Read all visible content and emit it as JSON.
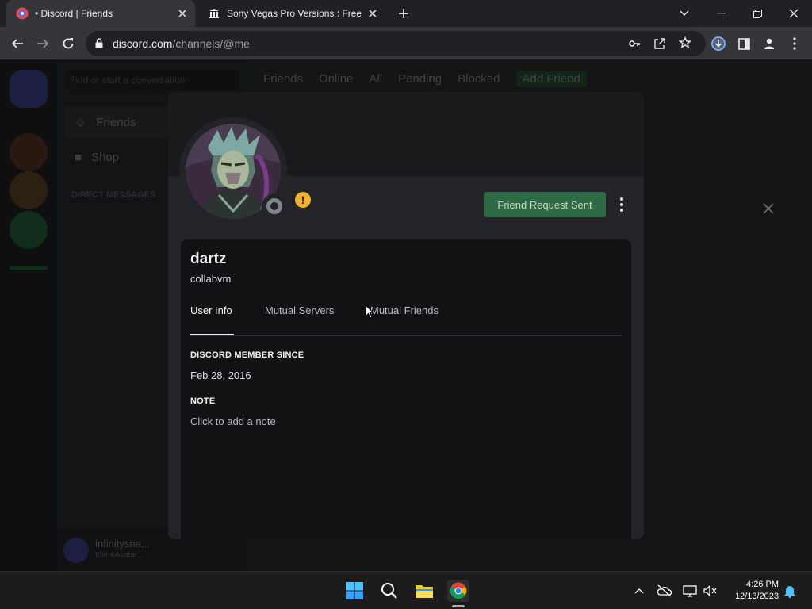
{
  "browser": {
    "tabs": [
      {
        "title": "• Discord | Friends",
        "active": true
      },
      {
        "title": "Sony Vegas Pro Versions : Free Do",
        "active": false
      }
    ],
    "url_host": "discord.com",
    "url_path": "/channels/@me"
  },
  "discord_bg": {
    "search_placeholder": "Find or start a conversation",
    "sidebar_nav": [
      "Friends",
      "Shop"
    ],
    "dm_header": "DIRECT MESSAGES",
    "topbar": {
      "friends": "Friends",
      "online": "Online",
      "all": "All",
      "pending": "Pending",
      "blocked": "Blocked",
      "add_friend": "Add Friend"
    },
    "user_name": "infinitysna...",
    "user_status": "Idle #Avatar..."
  },
  "profile": {
    "display_name": "dartz",
    "username": "collabvm",
    "friend_button": "Friend Request Sent",
    "tabs": [
      "User Info",
      "Mutual Servers",
      "Mutual Friends"
    ],
    "member_since_label": "DISCORD MEMBER SINCE",
    "member_since_value": "Feb 28, 2016",
    "note_label": "NOTE",
    "note_placeholder": "Click to add a note"
  },
  "taskbar": {
    "time": "4:26 PM",
    "date": "12/13/2023"
  },
  "colors": {
    "discord_blurple": "#5865f2",
    "friend_button_green": "#2d6a45",
    "warning_yellow": "#f0b232",
    "modal_bg": "#232428",
    "inner_bg": "#111214"
  }
}
